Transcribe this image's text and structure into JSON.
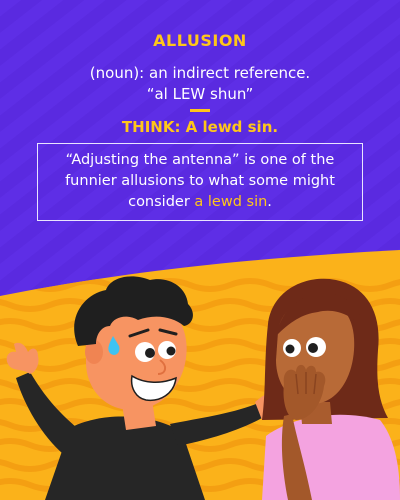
{
  "colors": {
    "background_purple": "#5a2ae0",
    "background_yellow": "#fbb21a",
    "accent": "#ffc61a",
    "text": "#ffffff"
  },
  "definition": {
    "word": "ALLUSION",
    "part_of_speech": "(noun): an indirect reference.",
    "pronunciation": "“al LEW shun”",
    "mnemonic": "THINK: A lewd sin."
  },
  "example": {
    "sentence_start": "“Adjusting the antenna” is one of the funnier allusions to what some might consider ",
    "highlight": "a lewd sin",
    "sentence_end": "."
  }
}
